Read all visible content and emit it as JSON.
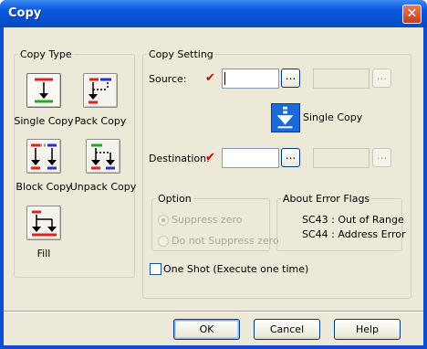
{
  "window": {
    "title": "Copy",
    "close_glyph": "✕"
  },
  "copy_type": {
    "legend": "Copy Type",
    "items": [
      {
        "label": "Single Copy",
        "icon": "single-copy-icon",
        "selected": true
      },
      {
        "label": "Pack Copy",
        "icon": "pack-copy-icon",
        "selected": false
      },
      {
        "label": "Block Copy",
        "icon": "block-copy-icon",
        "selected": false
      },
      {
        "label": "Unpack Copy",
        "icon": "unpack-copy-icon",
        "selected": false
      },
      {
        "label": "Fill",
        "icon": "fill-icon",
        "selected": false
      }
    ]
  },
  "copy_setting": {
    "legend": "Copy Setting",
    "source_label": "Source:",
    "source_value": "",
    "destination_label": "Destination:",
    "destination_value": "",
    "browse_label": "...",
    "mode_label": "Single Copy",
    "required_mark": "✔"
  },
  "option": {
    "legend": "Option",
    "suppress_zero": "Suppress zero",
    "do_not_suppress": "Do not Suppress zero",
    "selected": "Suppress zero",
    "enabled": false
  },
  "error_flags": {
    "legend": "About Error Flags",
    "lines": [
      "SC43 : Out of Range",
      "SC44 : Address Error"
    ]
  },
  "one_shot": {
    "label": "One Shot (Execute one time)",
    "checked": false
  },
  "buttons": {
    "ok": "OK",
    "cancel": "Cancel",
    "help": "Help"
  },
  "colors": {
    "title_bar": "#0a4fd0",
    "face": "#ece9d8",
    "check_mark": "#cc0000",
    "mode_icon": "#1c6ad8"
  }
}
